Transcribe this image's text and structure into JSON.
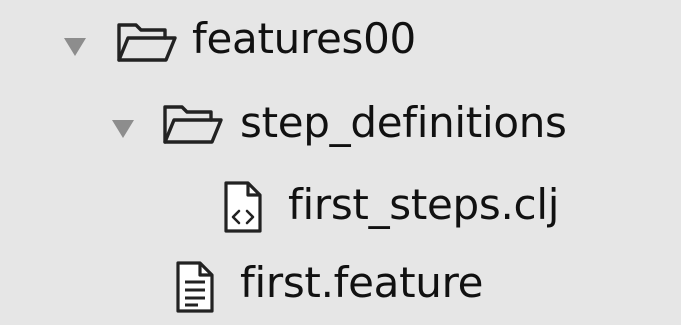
{
  "tree": {
    "items": [
      {
        "label": "features00",
        "type": "folder",
        "expanded": true,
        "icon": "folder-open-icon",
        "disclosure_icon": "disclosure-triangle-down-icon"
      },
      {
        "label": "step_definitions",
        "type": "folder",
        "expanded": true,
        "icon": "folder-open-icon",
        "disclosure_icon": "disclosure-triangle-down-icon"
      },
      {
        "label": "first_steps.clj",
        "type": "file",
        "icon": "code-file-icon"
      },
      {
        "label": "first.feature",
        "type": "file",
        "icon": "text-file-icon"
      }
    ]
  },
  "colors": {
    "background": "#e6e6e6",
    "text": "#111111",
    "disclosure": "#8d8d8d"
  }
}
